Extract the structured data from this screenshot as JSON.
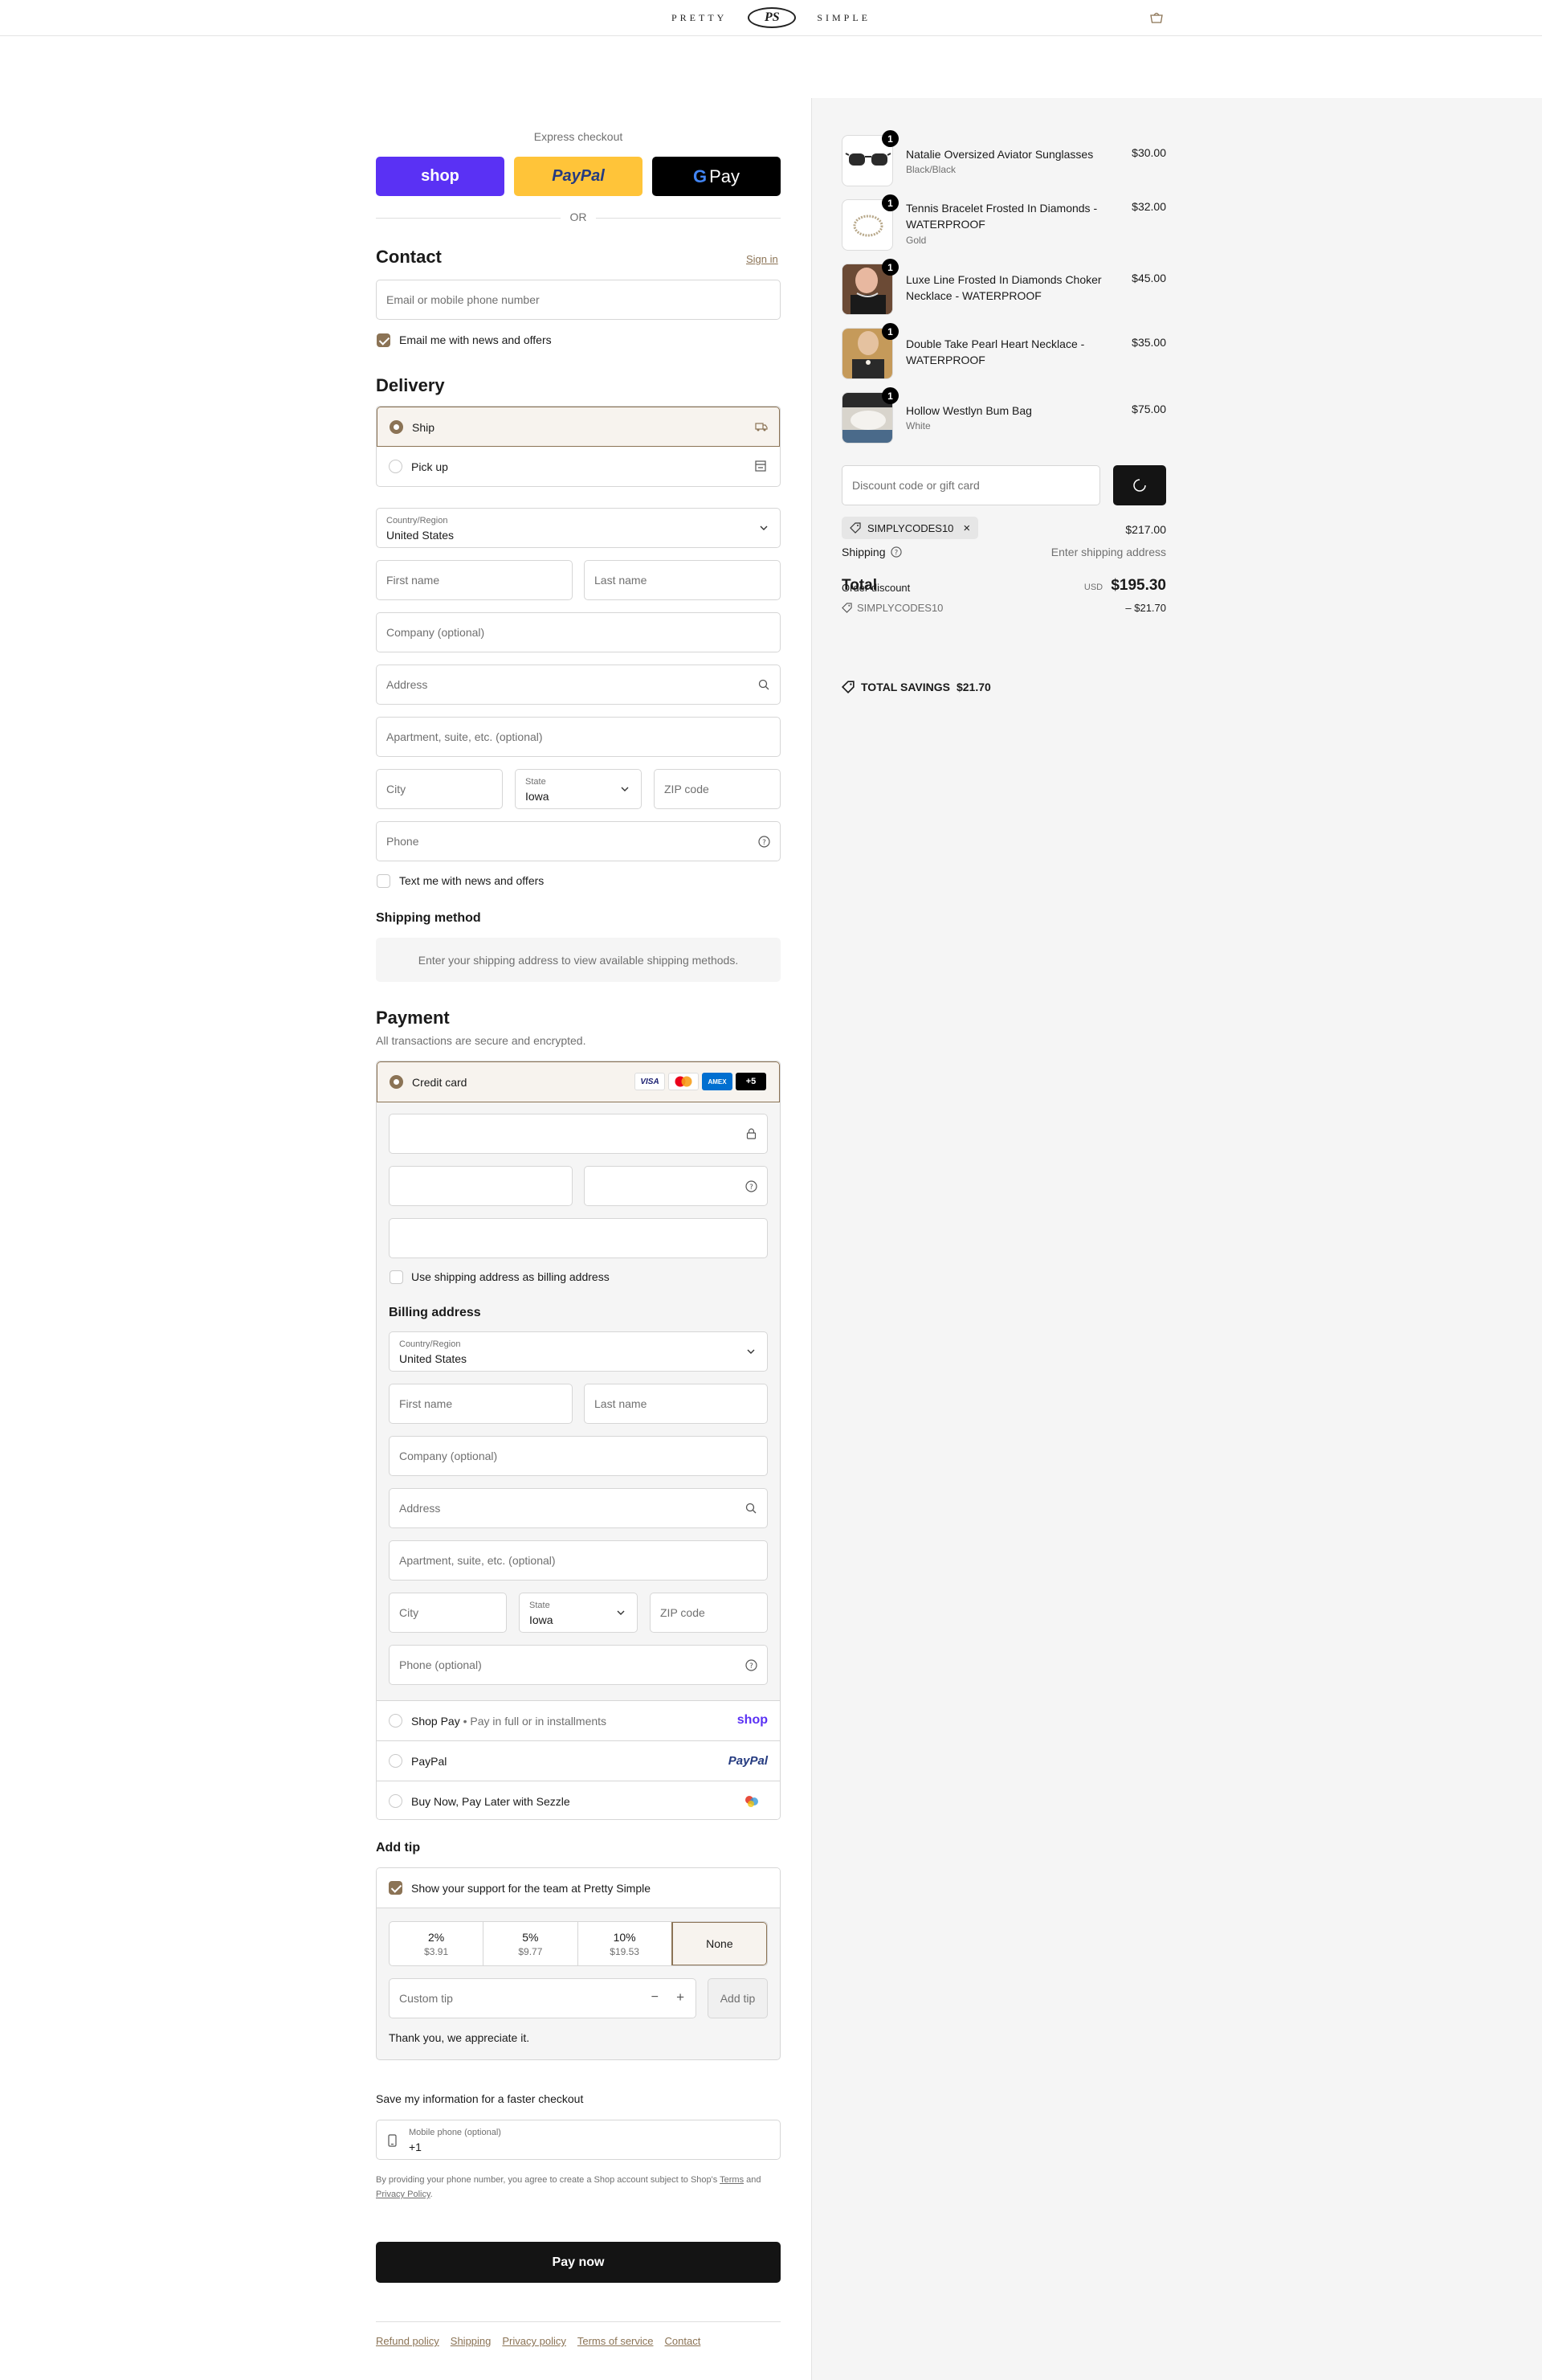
{
  "header": {
    "logo_left": "PRETTY",
    "logo_mono": "PS",
    "logo_right": "SIMPLE"
  },
  "express": {
    "title": "Express checkout",
    "shop_label": "shop",
    "paypal_label": "PayPal",
    "gpay_label": "Pay",
    "or_label": "OR"
  },
  "contact": {
    "title": "Contact",
    "sign_in": "Sign in",
    "email_placeholder": "Email or mobile phone number",
    "news_label": "Email me with news and offers"
  },
  "delivery": {
    "title": "Delivery",
    "ship_label": "Ship",
    "pickup_label": "Pick up",
    "country_label": "Country/Region",
    "country_value": "United States",
    "first_name": "First name",
    "last_name": "Last name",
    "company": "Company (optional)",
    "address": "Address",
    "apartment": "Apartment, suite, etc. (optional)",
    "city": "City",
    "state_label": "State",
    "state_value": "Iowa",
    "zip": "ZIP code",
    "phone": "Phone",
    "text_news": "Text me with news and offers"
  },
  "shipping_method": {
    "title": "Shipping method",
    "message": "Enter your shipping address to view available shipping methods."
  },
  "payment": {
    "title": "Payment",
    "subtitle": "All transactions are secure and encrypted.",
    "credit_card": "Credit card",
    "card_logos": [
      "VISA",
      "",
      "AMEX",
      "+5"
    ],
    "use_shipping": "Use shipping address as billing address",
    "billing_title": "Billing address",
    "country_label": "Country/Region",
    "country_value": "United States",
    "first_name": "First name",
    "last_name": "Last name",
    "company": "Company (optional)",
    "address": "Address",
    "apartment": "Apartment, suite, etc. (optional)",
    "city": "City",
    "state_label": "State",
    "state_value": "Iowa",
    "zip": "ZIP code",
    "phone": "Phone (optional)",
    "shoppay_label": "Shop Pay",
    "shoppay_sub": "Pay in full or in installments",
    "shoppay_logo": "shop",
    "paypal_label": "PayPal",
    "paypal_logo": "PayPal",
    "sezzle_label": "Buy Now, Pay Later with Sezzle"
  },
  "tip": {
    "title": "Add tip",
    "support_label": "Show your support for the team at Pretty Simple",
    "options": [
      {
        "pct": "2%",
        "amt": "$3.91"
      },
      {
        "pct": "5%",
        "amt": "$9.77"
      },
      {
        "pct": "10%",
        "amt": "$19.53"
      }
    ],
    "none_label": "None",
    "custom_placeholder": "Custom tip",
    "add_tip": "Add tip",
    "thanks": "Thank you, we appreciate it."
  },
  "save_info": {
    "title": "Save my information for a faster checkout",
    "mobile_label": "Mobile phone (optional)",
    "mobile_value": "+1",
    "legal_prefix": "By providing your phone number, you agree to create a Shop account subject to Shop's",
    "terms": "Terms",
    "and": "and",
    "privacy": "Privacy Policy",
    "period": "."
  },
  "pay_now": "Pay now",
  "footer": {
    "links": [
      "Refund policy",
      "Shipping",
      "Privacy policy",
      "Terms of service",
      "Contact"
    ]
  },
  "summary": {
    "items": [
      {
        "qty": "1",
        "name": "Natalie Oversized Aviator Sunglasses",
        "variant": "Black/Black",
        "price": "$30.00"
      },
      {
        "qty": "1",
        "name": "Tennis Bracelet Frosted In Diamonds - WATERPROOF",
        "variant": "Gold",
        "price": "$32.00"
      },
      {
        "qty": "1",
        "name": "Luxe Line Frosted In Diamonds Choker Necklace - WATERPROOF",
        "variant": "",
        "price": "$45.00"
      },
      {
        "qty": "1",
        "name": "Double Take Pearl Heart Necklace - WATERPROOF",
        "variant": "",
        "price": "$35.00"
      },
      {
        "qty": "1",
        "name": "Hollow Westlyn Bum Bag",
        "variant": "White",
        "price": "$75.00"
      }
    ],
    "discount_placeholder": "Discount code or gift card",
    "applied_code": "SIMPLYCODES10",
    "subtotal_value": "$217.00",
    "shipping_label": "Shipping",
    "shipping_value": "Enter shipping address",
    "order_discount_label": "Order discount",
    "total_label": "Total",
    "discount_code": "SIMPLYCODES10",
    "discount_value": "– $21.70",
    "currency": "USD",
    "total_value": "$195.30",
    "savings_label": "TOTAL SAVINGS",
    "savings_value": "$21.70"
  }
}
